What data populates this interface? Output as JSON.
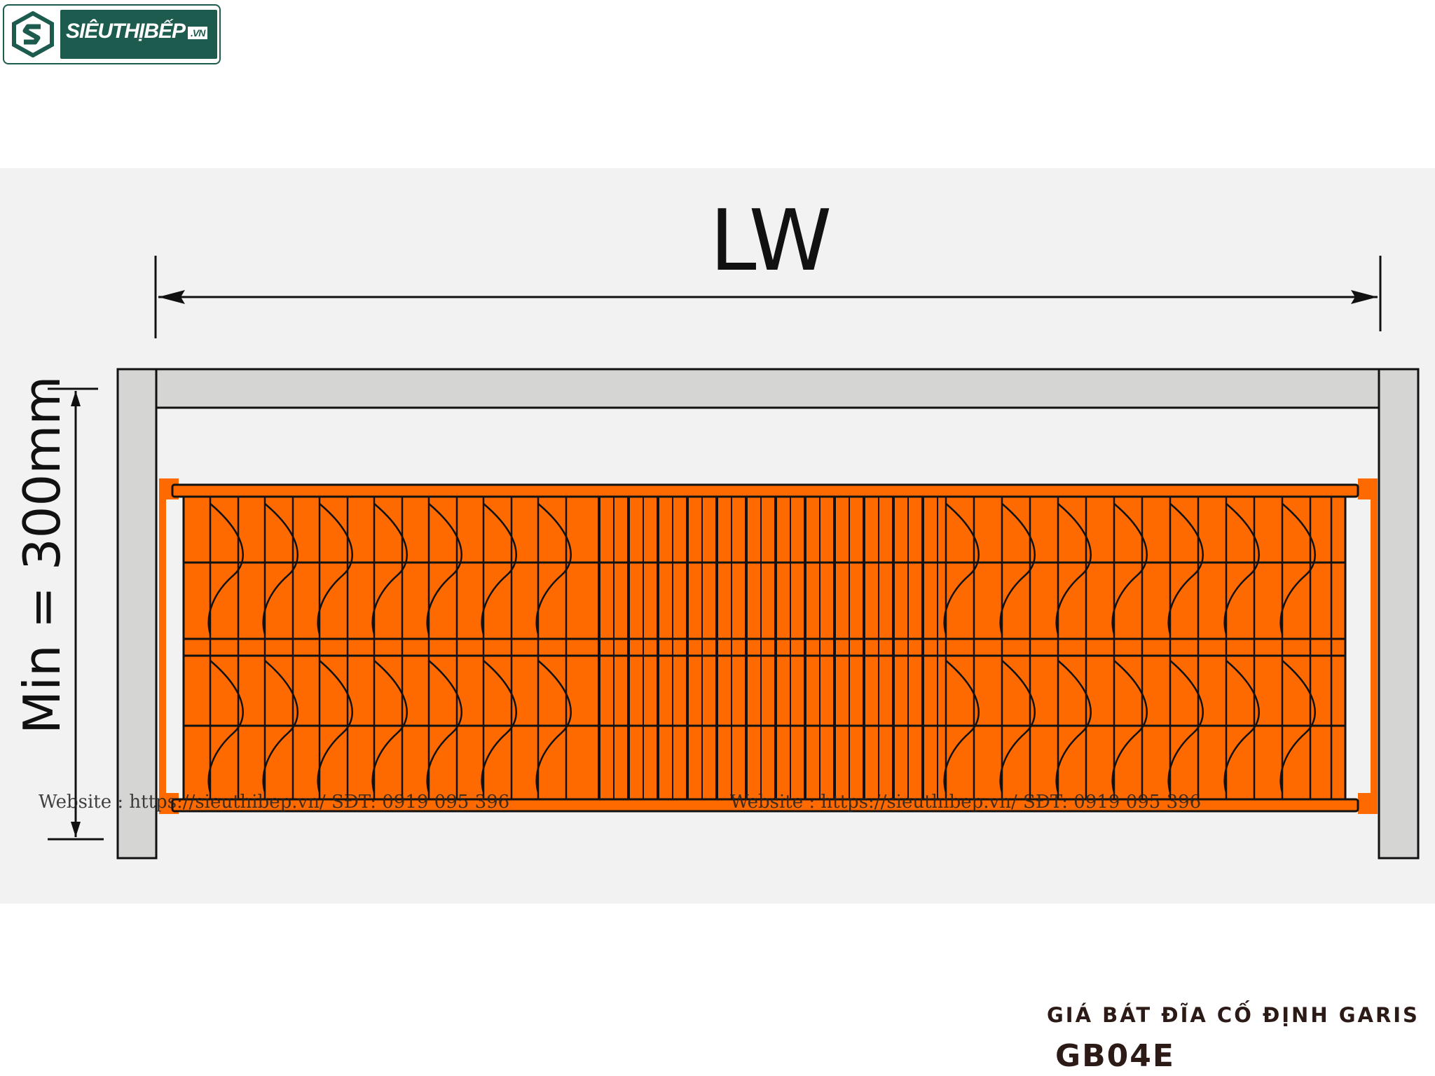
{
  "logo": {
    "text": "SIÊUTHỊBẾP",
    "suffix": ".VN",
    "mark_icon": "s-hexagon-logo-icon",
    "brand_color": "#1e5b4f"
  },
  "diagram": {
    "width_label": "LW",
    "height_label": "Min = 300mm",
    "basket_color": "#ff6a00",
    "frame_color": "#d5d6d3",
    "background_color": "#f1f2f1"
  },
  "watermarks": [
    "Website : https://sieuthibep.vn/   SĐT: 0919 095 396",
    "Website : https://sieuthibep.vn/   SĐT: 0919 095 396"
  ],
  "product": {
    "title": "GIÁ BÁT ĐĨA CỐ ĐỊNH GARIS",
    "code": "GB04E"
  }
}
